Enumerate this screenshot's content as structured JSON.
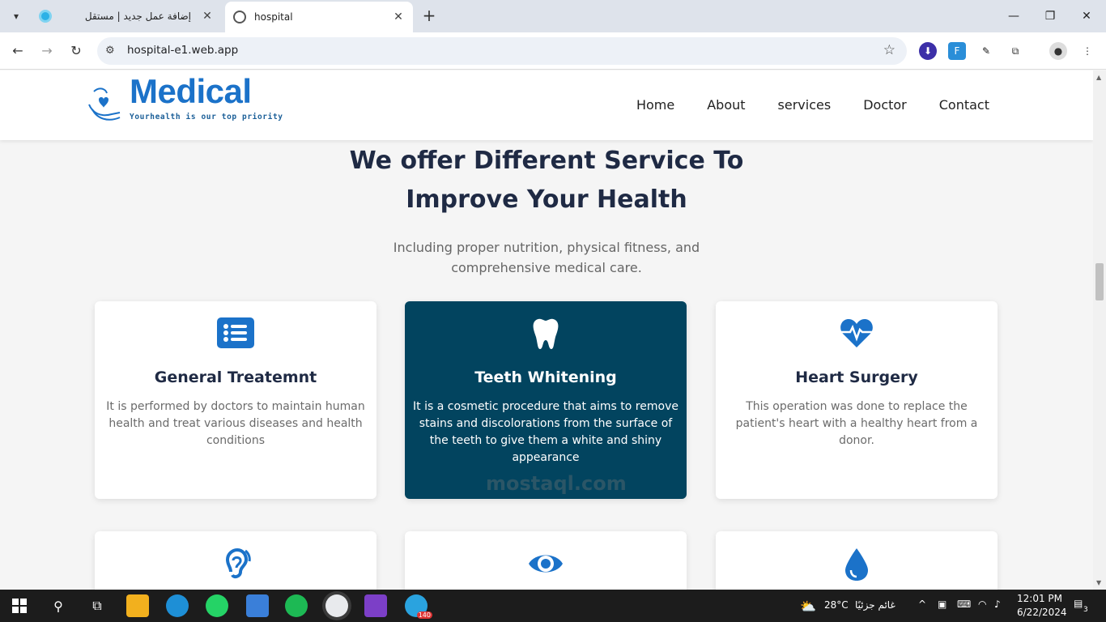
{
  "browser": {
    "tabs": [
      {
        "title": "إضافة عمل جديد | مستقل",
        "active": false
      },
      {
        "title": "hospital",
        "active": true
      }
    ],
    "url": "hospital-e1.web.app"
  },
  "site": {
    "logo": {
      "name": "Medical",
      "tagline": "Yourhealth is our top priority"
    },
    "nav": [
      "Home",
      "About",
      "services",
      "Doctor",
      "Contact"
    ],
    "heading_line1": "We offer Different Service To",
    "heading_line2": "Improve Your Health",
    "subheading_line1": "Including proper nutrition, physical fitness, and",
    "subheading_line2": "comprehensive medical care.",
    "services": [
      {
        "title": "General Treatemnt",
        "icon": "list-icon",
        "description": "It is performed by doctors to maintain human health and treat various diseases and health conditions"
      },
      {
        "title": "Teeth Whitening",
        "icon": "tooth-icon",
        "description": "It is a cosmetic procedure that aims to remove stains and discolorations from the surface of the teeth to give them a white and shiny appearance"
      },
      {
        "title": "Heart Surgery",
        "icon": "heartbeat-icon",
        "description": "This operation was done to replace the patient's heart with a healthy heart from a donor."
      }
    ],
    "services_row2_icons": [
      "ear-icon",
      "eye-icon",
      "drop-icon"
    ],
    "colors": {
      "primary": "#1b72c9",
      "active_card": "#02445f",
      "heading": "#1f2a44"
    }
  },
  "watermark": "mostaql.com",
  "taskbar": {
    "weather_temp": "28°C",
    "weather_desc": "غائم جزئيًا",
    "time": "12:01 PM",
    "date": "6/22/2024",
    "notifications": "3",
    "telegram_badge": "140"
  }
}
